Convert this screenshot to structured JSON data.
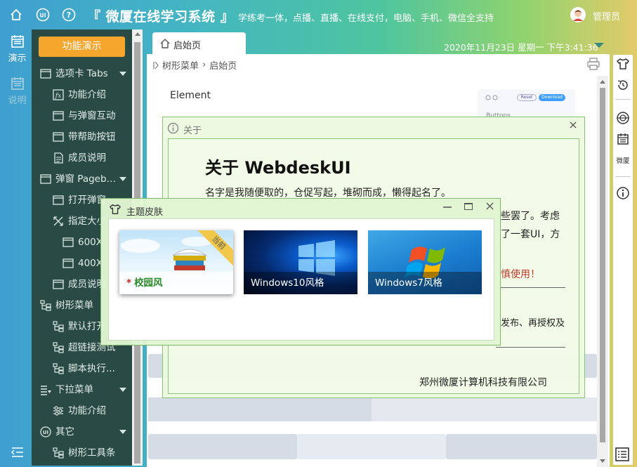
{
  "header": {
    "title": "『 微厦在线学习系统 』",
    "slogan": "学练考一体，点播、直播、在线支付，电脑、手机、微信全支持",
    "user_name": "管理员"
  },
  "left_rail": {
    "items": [
      {
        "label": "演示",
        "icon": "calendar-icon"
      },
      {
        "label": "说明",
        "icon": "calendar-icon"
      }
    ]
  },
  "sidebar": {
    "function_button": "功能演示",
    "items": [
      {
        "label": "选项卡 Tabs",
        "icon": "tabs-icon",
        "expandable": true
      },
      {
        "label": "功能介绍",
        "icon": "function-icon"
      },
      {
        "label": "与弹窗互动",
        "icon": "window-icon"
      },
      {
        "label": "带帮助按钮",
        "icon": "window-icon"
      },
      {
        "label": "成员说明",
        "icon": "document-icon"
      },
      {
        "label": "弹窗 Pageb…",
        "icon": "window-icon",
        "expandable": true
      },
      {
        "label": "打开弹窗",
        "icon": "window-icon"
      },
      {
        "label": "指定大小",
        "icon": "resize-icon"
      },
      {
        "label": "600X",
        "icon": "window-icon"
      },
      {
        "label": "400X",
        "icon": "window-icon"
      },
      {
        "label": "成员说明",
        "icon": "window-icon"
      },
      {
        "label": "树形菜单",
        "icon": "tree-icon",
        "expandable": true
      },
      {
        "label": "默认打开",
        "icon": "tree-icon"
      },
      {
        "label": "超链接测试",
        "icon": "tree-icon"
      },
      {
        "label": "脚本执行...",
        "icon": "tree-icon"
      },
      {
        "label": "下拉菜单",
        "icon": "dropdown-menu-icon",
        "expandable": true
      },
      {
        "label": "功能介绍",
        "icon": "sliders-icon"
      },
      {
        "label": "其它",
        "icon": "ui-icon",
        "expandable": true
      },
      {
        "label": "树形工具条",
        "icon": "tree-icon"
      }
    ]
  },
  "main": {
    "tab_label": "启始页",
    "datetime": "2020年11月23日 星期一 下午3:41:36",
    "breadcrumb": {
      "root": "树形菜单",
      "separator": "›",
      "current": "启始页"
    },
    "element_label": "Element",
    "preview": {
      "reset": "Reset",
      "download": "Download",
      "buttons": "Buttons"
    }
  },
  "about_dialog": {
    "title": "关于",
    "heading": "关于 WebdeskUI",
    "paragraph1": "名字是我随便取的，仓促写起，堆砌而成，懒得起名了。",
    "line2": "些罢了。考虑",
    "line3": "了一套UI，方",
    "warning": "慎使用！",
    "line4": "发布、再授权及",
    "company": "郑州微厦计算机科技有限公司"
  },
  "theme_dialog": {
    "title": "主题皮肤",
    "skins": [
      {
        "label": "校园风",
        "current": true,
        "badge": "当前"
      },
      {
        "label": "Windows10风格",
        "current": false
      },
      {
        "label": "Windows7风格",
        "current": false
      }
    ]
  },
  "colors": {
    "accent": "#f6a62c",
    "sidebar_bg": "#2a4a45",
    "dialog_border": "#86c470",
    "warning": "#c0392b"
  }
}
